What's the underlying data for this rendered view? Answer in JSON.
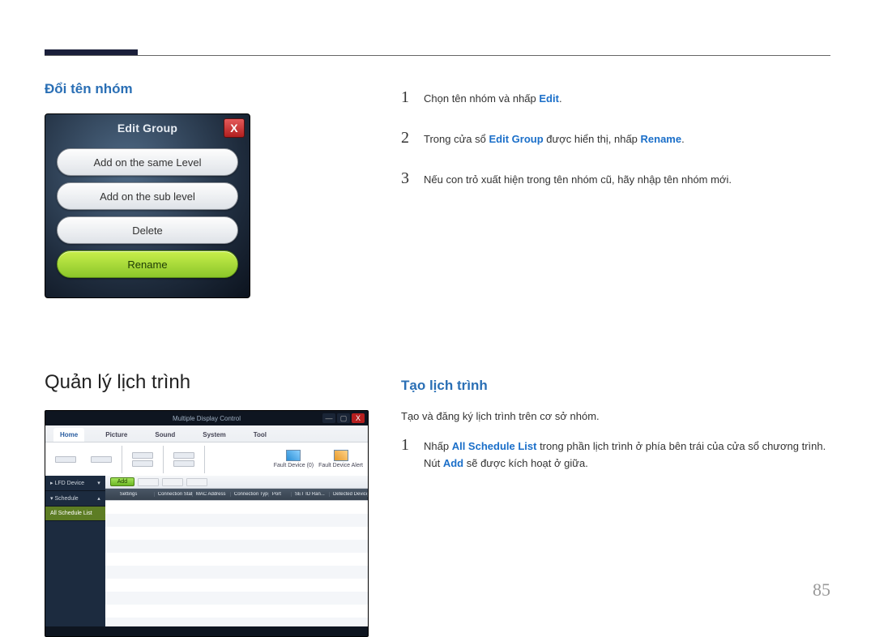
{
  "section1": {
    "heading": "Đổi tên nhóm",
    "dialog": {
      "title": "Edit Group",
      "close_glyph": "X",
      "buttons": [
        "Add on the same Level",
        "Add on the sub level",
        "Delete",
        "Rename"
      ]
    },
    "steps": {
      "s1_pre": "Chọn tên nhóm và nhấp ",
      "s1_kw": "Edit",
      "s1_post": ".",
      "s2_pre": "Trong cửa sổ ",
      "s2_kw1": "Edit Group",
      "s2_mid": " được hiển thị, nhấp ",
      "s2_kw2": "Rename",
      "s2_post": ".",
      "s3": "Nếu con trỏ xuất hiện trong tên nhóm cũ, hãy nhập tên nhóm mới."
    }
  },
  "section2": {
    "main_heading": "Quản lý lịch trình",
    "sub_heading": "Tạo lịch trình",
    "intro": "Tạo và đăng ký lịch trình trên cơ sở nhóm.",
    "steps": {
      "s1_pre": "Nhấp ",
      "s1_kw1": "All Schedule List",
      "s1_mid": " trong phần lịch trình ở phía bên trái của cửa sổ chương trình. Nút ",
      "s1_kw2": "Add",
      "s1_post": " sẽ được kích hoạt ở giữa."
    }
  },
  "mdc": {
    "title": "Multiple Display Control",
    "win_min": "—",
    "win_max": "▢",
    "win_close": "X",
    "tabs": [
      "Home",
      "Picture",
      "Sound",
      "System",
      "Tool"
    ],
    "ribbon_labels": [
      "Fault Device (0)",
      "Fault Device Alert"
    ],
    "sidebar": {
      "item0": "LFD Device",
      "item1": "Schedule",
      "item2": "All Schedule List"
    },
    "toolbar": {
      "add": "Add"
    },
    "columns": [
      "",
      "Settings",
      "Connection Status",
      "MAC Address",
      "Connection Type",
      "Port",
      "SET ID Ran...",
      "Detected Devices"
    ]
  },
  "page_number": "85",
  "nums": {
    "1": "1",
    "2": "2",
    "3": "3"
  }
}
